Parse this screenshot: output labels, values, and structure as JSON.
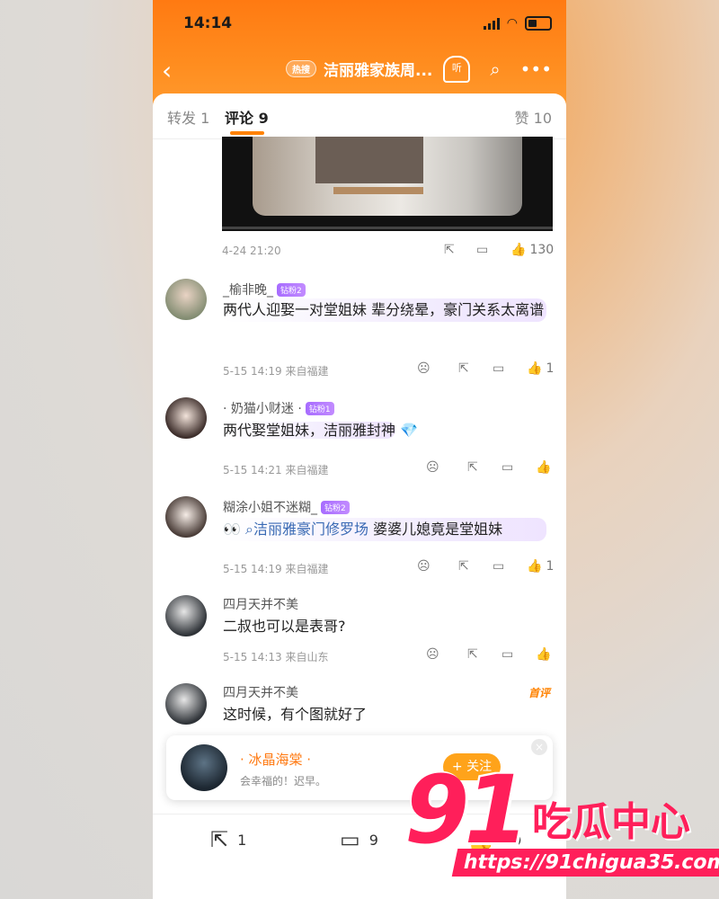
{
  "status": {
    "time": "14:14"
  },
  "nav": {
    "back_icon": "chevron-left-icon",
    "hot_badge": "热搜",
    "title": "洁丽雅家族周...",
    "listen_label": "听"
  },
  "tabs": [
    {
      "label": "转发 1"
    },
    {
      "label": "评论 9"
    },
    {
      "label": "赞 10"
    }
  ],
  "post": {
    "date": "4-24 21:20",
    "likes": "130"
  },
  "comments": [
    {
      "user": "_榆非晚_",
      "badge": "钻粉2",
      "text": "两代人迎娶一对堂姐妹 辈分绕晕，豪门关系太离谱",
      "meta": "5-15 14:19 来自福建",
      "likes": "1"
    },
    {
      "user": "· 奶猫小财迷 ·",
      "badge": "钻粉1",
      "text": "两代娶堂姐妹，洁丽雅封神",
      "meta": "5-15 14:21 来自福建",
      "likes": ""
    },
    {
      "user": "糊涂小姐不迷糊_",
      "badge": "钻粉2",
      "emoji": "👀",
      "topic": "洁丽雅豪门修罗场",
      "text": "婆婆儿媳竟是堂姐妹",
      "meta": "5-15 14:19 来自福建",
      "likes": "1"
    },
    {
      "user": "四月天并不美",
      "badge": "",
      "text": "二叔也可以是表哥?",
      "meta": "5-15 14:13 来自山东",
      "likes": ""
    },
    {
      "user": "四月天并不美",
      "badge": "",
      "hot": "首评",
      "text": "这时候，有个图就好了",
      "meta": "",
      "likes": ""
    }
  ],
  "recommend": {
    "name": "· 冰晶海棠 ·",
    "sub": "会幸福的！迟早。",
    "follow": "+ 关注",
    "close": "×"
  },
  "bottom": {
    "repost": "1",
    "comment": "9",
    "like": "10"
  },
  "watermark": {
    "num": "91",
    "cn": "吃瓜中心",
    "url": "https://91chigua35.com"
  },
  "colors": {
    "accent": "#ff8200",
    "vip": "#b26bff",
    "watermark": "#ff1f5a"
  }
}
